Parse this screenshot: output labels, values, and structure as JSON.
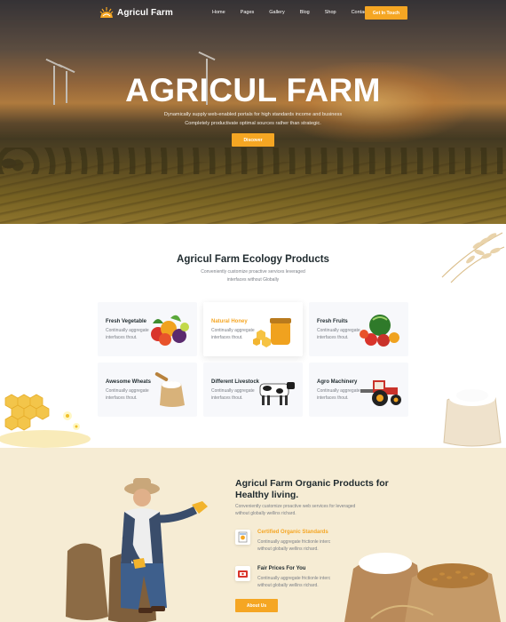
{
  "brand": {
    "name": "Agricul Farm",
    "accent": "#f5a623"
  },
  "nav": {
    "items": [
      "Home",
      "Pages",
      "Gallery",
      "Blog",
      "Shop",
      "Contact"
    ],
    "cta": "Get In Touch"
  },
  "hero": {
    "title": "AGRICUL FARM",
    "subtitle_line1": "Dynamically supply web-enabled portals for high standards income and business",
    "subtitle_line2": "Completely productivate optimal sources rather than strategic.",
    "button": "Discover"
  },
  "products": {
    "title": "Agricul Farm Ecology Products",
    "subtitle_line1": "Conveniently customize proactive services leveraged",
    "subtitle_line2": "interfaces without Globally",
    "cards": [
      {
        "title": "Fresh Vegetable",
        "desc": "Continually aggregate interfaces thout.",
        "icon": "vegetables-icon"
      },
      {
        "title": "Natural Honey",
        "desc": "Continually aggregate interfaces thout.",
        "icon": "honey-jar-icon"
      },
      {
        "title": "Fresh Fruits",
        "desc": "Continually aggregate interfaces thout.",
        "icon": "fruits-icon"
      },
      {
        "title": "Awesome Wheats",
        "desc": "Continually aggregate interfaces thout.",
        "icon": "flour-sack-icon"
      },
      {
        "title": "Different Livestock",
        "desc": "Continually aggregate interfaces thout.",
        "icon": "cow-icon"
      },
      {
        "title": "Agro Machinery",
        "desc": "Continually aggregate interfaces thout.",
        "icon": "tractor-icon"
      }
    ]
  },
  "organic": {
    "title_line1": "Agricul Farm Organic Products for",
    "title_line2": "Healthy living.",
    "subtitle_line1": "Conveniently customize proactive web services for leveraged",
    "subtitle_line2": "without globally wellins richard.",
    "features": [
      {
        "title": "Certified Organic Standards",
        "desc_line1": "Continually aggregate frictionle interc",
        "desc_line2": "without globally wellins richard."
      },
      {
        "title": "Fair Prices For You",
        "desc_line1": "Continually aggregate frictionle interc",
        "desc_line2": "without globally wellins richard."
      }
    ],
    "button": "About Us"
  }
}
